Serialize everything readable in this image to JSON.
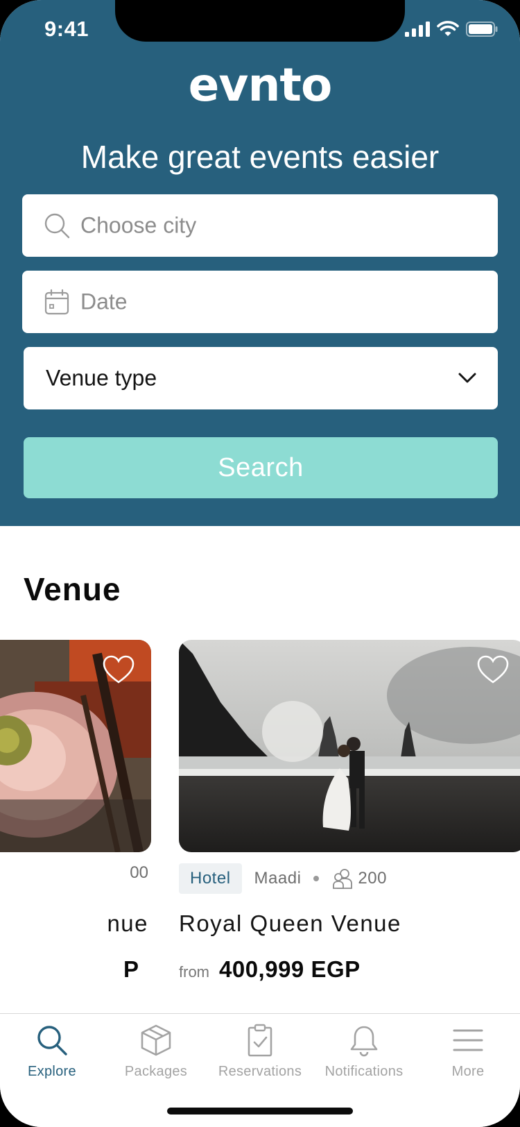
{
  "status_bar": {
    "time": "9:41"
  },
  "header": {
    "logo": "evnto",
    "tagline": "Make great events easier",
    "city_placeholder": "Choose city",
    "date_placeholder": "Date",
    "venue_type_value": "Venue type",
    "search_label": "Search"
  },
  "venues": {
    "title": "Venue",
    "left_card": {
      "capacity_partial": "00",
      "name_partial": "nue",
      "price_partial": "P"
    },
    "right_card": {
      "type_badge": "Hotel",
      "location": "Maadi",
      "capacity": "200",
      "name": "Royal Queen Venue",
      "price_prefix": "from",
      "price": "400,999 EGP"
    }
  },
  "tabbar": {
    "items": [
      {
        "label": "Explore",
        "icon": "search-icon",
        "active": true
      },
      {
        "label": "Packages",
        "icon": "package-icon",
        "active": false
      },
      {
        "label": "Reservations",
        "icon": "clipboard-icon",
        "active": false
      },
      {
        "label": "Notifications",
        "icon": "bell-icon",
        "active": false
      },
      {
        "label": "More",
        "icon": "menu-icon",
        "active": false
      }
    ]
  },
  "colors": {
    "brand": "#27607d",
    "accent": "#8ddcd3",
    "active_tab": "#27607d",
    "inactive_tab": "#a3a3a3"
  }
}
